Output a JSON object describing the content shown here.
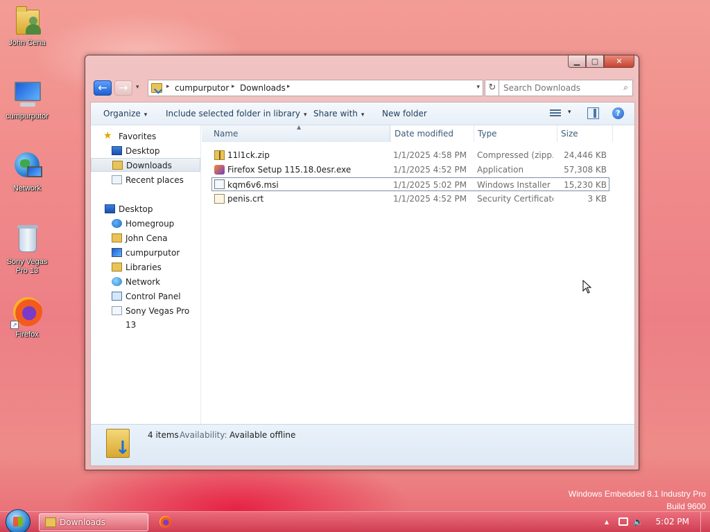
{
  "desktop": {
    "icons": [
      {
        "label": "John Cena",
        "icon": "user-folder-icon"
      },
      {
        "label": "cumpurputor",
        "icon": "computer-icon"
      },
      {
        "label": "Network",
        "icon": "network-icon"
      },
      {
        "label": "Sony Vegas Pro 13",
        "icon": "recycle-bin-icon"
      },
      {
        "label": "Firefox",
        "icon": "firefox-icon"
      }
    ],
    "watermark": {
      "line1": "Windows Embedded 8.1 Industry Pro",
      "line2": "Build 9600"
    }
  },
  "window": {
    "controls": {
      "minimize": "▁",
      "maximize": "▢",
      "close": "✕"
    },
    "address": {
      "crumbs": [
        "cumpurputor",
        "Downloads"
      ],
      "separator": "▸",
      "dropdown": "▾"
    },
    "nav": {
      "back": "←",
      "forward": "→",
      "recent": "▾",
      "refresh": "↻"
    },
    "search": {
      "placeholder": "Search Downloads",
      "icon": "⌕"
    },
    "toolbar": {
      "organize": "Organize",
      "include": "Include selected folder in library",
      "share": "Share with",
      "new_folder": "New folder",
      "dropdown_arrow": "▾",
      "help": "?"
    },
    "navpane": {
      "favorites": {
        "label": "Favorites",
        "items": [
          "Desktop",
          "Downloads",
          "Recent places"
        ]
      },
      "desktop": {
        "label": "Desktop",
        "items": [
          "Homegroup",
          "John Cena",
          "cumpurputor",
          "Libraries",
          "Network",
          "Control Panel",
          "Sony Vegas Pro 13"
        ]
      },
      "selected": "Downloads"
    },
    "columns": {
      "name": "Name",
      "date": "Date modified",
      "type": "Type",
      "size": "Size",
      "sort_caret": "▲"
    },
    "files": [
      {
        "name": "11l1ck.zip",
        "date": "1/1/2025 4:58 PM",
        "type": "Compressed (zipp...",
        "size": "24,446 KB",
        "icon": "zip-icon"
      },
      {
        "name": "Firefox Setup 115.18.0esr.exe",
        "date": "1/1/2025 4:52 PM",
        "type": "Application",
        "size": "57,308 KB",
        "icon": "installer-exe-icon"
      },
      {
        "name": "kqm6v6.msi",
        "date": "1/1/2025 5:02 PM",
        "type": "Windows Installer ...",
        "size": "15,230 KB",
        "icon": "msi-icon"
      },
      {
        "name": "penis.crt",
        "date": "1/1/2025 4:52 PM",
        "type": "Security Certificate",
        "size": "3 KB",
        "icon": "certificate-icon"
      }
    ],
    "focused_file": "kqm6v6.msi",
    "details": {
      "count": "4 items",
      "availability_label": "Availability:",
      "availability_value": "Available offline"
    }
  },
  "taskbar": {
    "task_label": "Downloads",
    "tray": {
      "up_arrow": "▴",
      "clock": "5:02 PM"
    }
  }
}
